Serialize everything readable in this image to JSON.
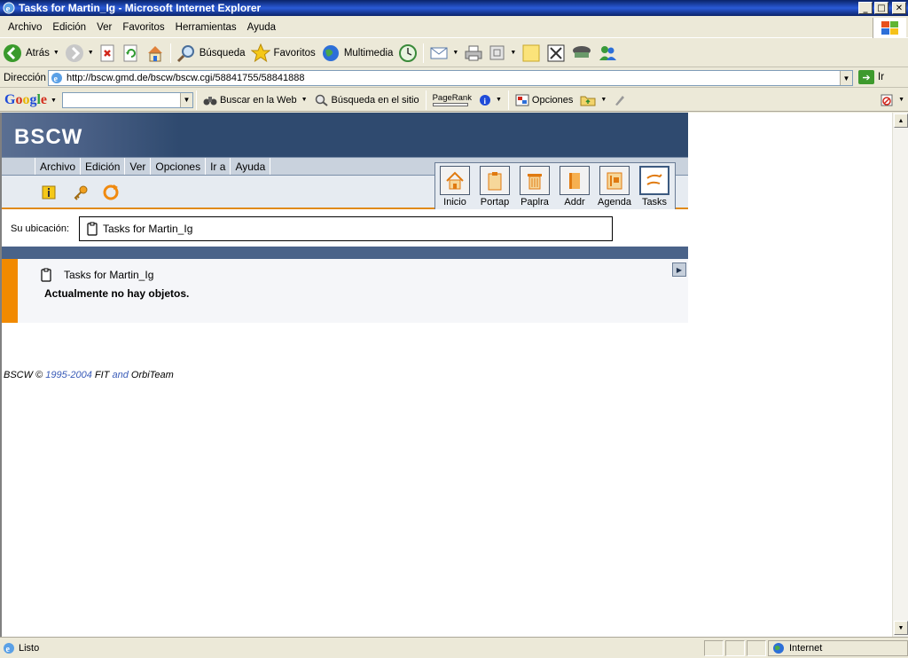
{
  "window": {
    "title": "Tasks for Martin_Ig - Microsoft Internet Explorer"
  },
  "menubar": [
    "Archivo",
    "Edición",
    "Ver",
    "Favoritos",
    "Herramientas",
    "Ayuda"
  ],
  "toolbar": {
    "back": "Atrás",
    "search": "Búsqueda",
    "favorites": "Favoritos",
    "multimedia": "Multimedia"
  },
  "address": {
    "label": "Dirección",
    "url": "http://bscw.gmd.de/bscw/bscw.cgi/58841755/58841888",
    "go": "Ir"
  },
  "google": {
    "search_web": "Buscar en la Web",
    "search_site": "Búsqueda en el sitio",
    "pagerank": "PageRank",
    "options": "Opciones"
  },
  "bscw": {
    "logo": "BSCW",
    "menu": [
      "Archivo",
      "Edición",
      "Ver",
      "Opciones",
      "Ir a",
      "Ayuda"
    ],
    "nav": [
      "Inicio",
      "Portap",
      "Paplra",
      "Addr",
      "Agenda",
      "Tasks"
    ],
    "location_label": "Su ubicación:",
    "location": "Tasks for Martin_Ig",
    "folder_title": "Tasks for Martin_Ig",
    "empty_message": "Actualmente no hay objetos.",
    "footer": {
      "prefix": "BSCW ©",
      "years": "1995-2004",
      "fit": "FIT",
      "and": "and",
      "orbiteam": "OrbiTeam"
    }
  },
  "status": {
    "text": "Listo",
    "zone": "Internet"
  }
}
